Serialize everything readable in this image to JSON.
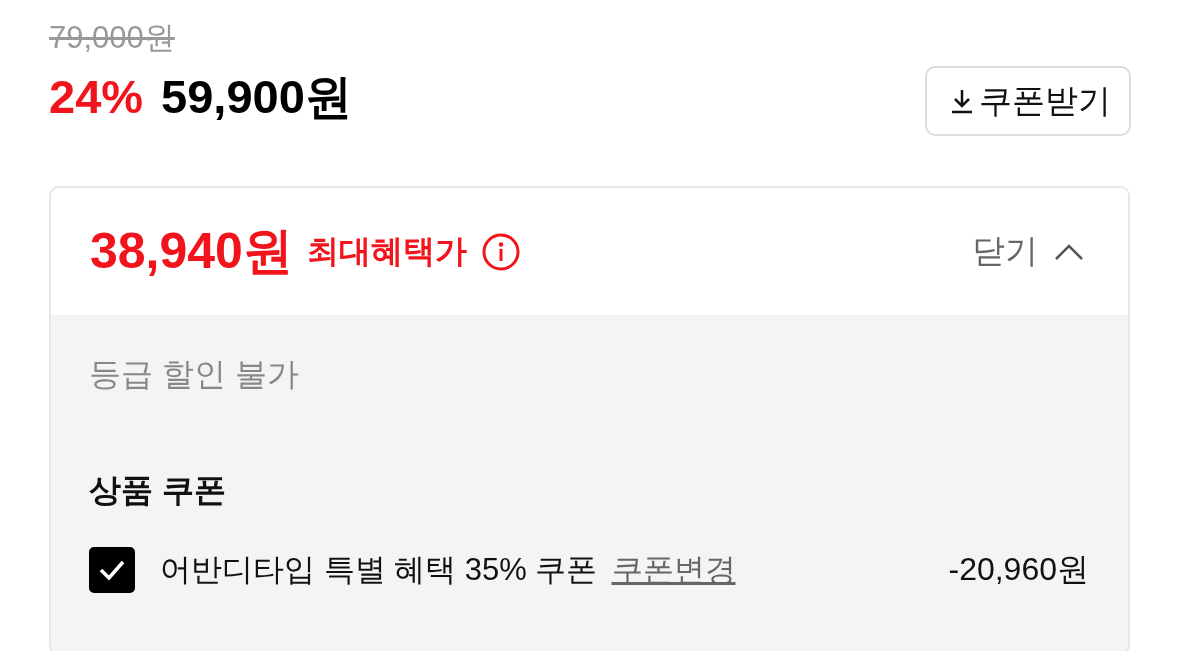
{
  "original_price": "79,000원",
  "discount_rate": "24%",
  "sale_price": "59,900원",
  "coupon_button": "쿠폰받기",
  "benefit": {
    "price": "38,940원",
    "label": "최대혜택가",
    "toggle_label": "닫기",
    "expanded": true
  },
  "grade_notice": "등급 할인 불가",
  "coupon_section": {
    "title": "상품 쿠폰",
    "coupons": [
      {
        "name": "어반디타입 특별 혜택 35% 쿠폰",
        "link": "쿠폰변경",
        "amount": "-20,960원",
        "checked": true
      }
    ]
  }
}
